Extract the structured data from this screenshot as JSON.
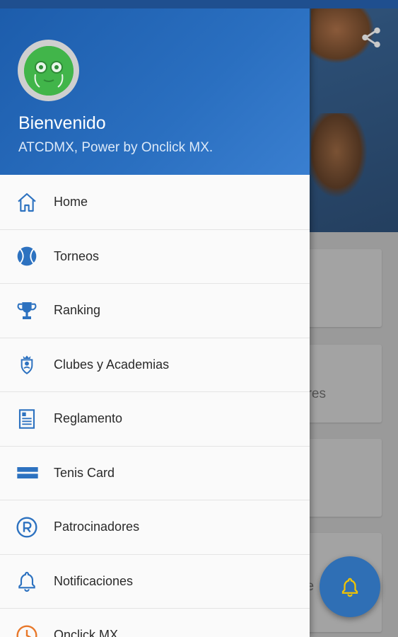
{
  "colors": {
    "primary": "#1c5cab",
    "icon": "#2d72c0",
    "fab": "#2f6fb5",
    "fab_icon": "#f2c400"
  },
  "header": {
    "welcome": "Bienvenido",
    "subtitle": "ATCDMX, Power by Onclick MX."
  },
  "menu": {
    "items": [
      {
        "label": "Home",
        "icon": "home-icon"
      },
      {
        "label": "Torneos",
        "icon": "tennis-ball-icon"
      },
      {
        "label": "Ranking",
        "icon": "trophy-icon"
      },
      {
        "label": "Clubes y Academias",
        "icon": "club-crest-icon"
      },
      {
        "label": "Reglamento",
        "icon": "document-icon"
      },
      {
        "label": "Tenis Card",
        "icon": "card-icon"
      },
      {
        "label": "Patrocinadores",
        "icon": "registered-icon"
      },
      {
        "label": "Notificaciones",
        "icon": "bell-icon"
      },
      {
        "label": "Onclick MX",
        "icon": "clock-icon"
      }
    ]
  },
  "background": {
    "card_text_1": "ores",
    "card_text_2": "Te"
  }
}
